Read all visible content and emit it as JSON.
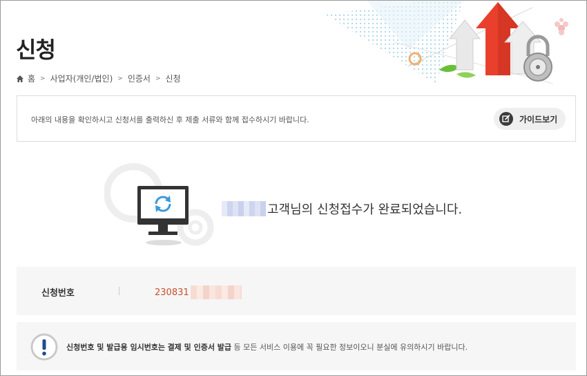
{
  "page": {
    "title": "신청"
  },
  "breadcrumb": {
    "items": [
      "홈",
      "사업자(개인/법인)",
      "인증서",
      "신청"
    ],
    "separator": ">"
  },
  "notice": {
    "text": "아래의 내용을 확인하시고 신청서를 출력하신 후 제출 서류와 함께 접수하시기 바랍니다.",
    "guide_button_label": "가이드보기"
  },
  "completion": {
    "message": "고객님의 신청접수가 완료되었습니다."
  },
  "application": {
    "label": "신청번호",
    "number_visible": "230831"
  },
  "warning": {
    "bold_1": "신청번호 및 발급용 임시번호는",
    "bold_2": "결제 및 인증서 발급",
    "rest": "등 모든 서비스 이용에 꼭 필요한 정보이오니 분실에 유의하시기 바랍니다."
  },
  "colors": {
    "accent_red": "#c8502a",
    "arrow_red": "#e8402c",
    "icon_blue": "#3a9ad9",
    "warning_blue": "#1f4d8c"
  }
}
